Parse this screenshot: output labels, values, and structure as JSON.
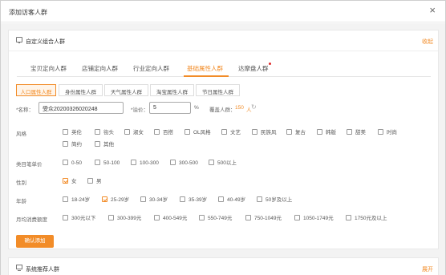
{
  "dialog": {
    "title": "添加访客人群",
    "close": "×"
  },
  "custom_panel": {
    "title": "自定义组合人群",
    "toggle": "收起"
  },
  "tabs": [
    {
      "label": "宝贝定向人群"
    },
    {
      "label": "店铺定向人群"
    },
    {
      "label": "行业定向人群"
    },
    {
      "label": "基础属性人群",
      "active": true
    },
    {
      "label": "达摩盘人群",
      "badge": true
    }
  ],
  "subtabs": [
    {
      "label": "人口属性人群",
      "active": true
    },
    {
      "label": "身份属性人群"
    },
    {
      "label": "天气属性人群"
    },
    {
      "label": "淘宝属性人群"
    },
    {
      "label": "节日属性人群"
    }
  ],
  "form": {
    "name_label": "*名称：",
    "name_value": "受众20200326020248",
    "premium_label": "*溢价：",
    "premium_value": "5",
    "premium_unit": "%",
    "cover_label": "覆盖人群：",
    "cover_value": "150",
    "cover_unit": "人"
  },
  "style": {
    "label": "风格",
    "options": [
      {
        "label": "英伦",
        "checked": false
      },
      {
        "label": "街头",
        "checked": false
      },
      {
        "label": "淑女",
        "checked": false
      },
      {
        "label": "百搭",
        "checked": false
      },
      {
        "label": "OL风格",
        "checked": false
      },
      {
        "label": "文艺",
        "checked": false
      },
      {
        "label": "民族风",
        "checked": false
      },
      {
        "label": "复古",
        "checked": false
      },
      {
        "label": "韩版",
        "checked": false
      },
      {
        "label": "甜美",
        "checked": false
      },
      {
        "label": "时尚",
        "checked": false
      },
      {
        "label": "简约",
        "checked": false
      },
      {
        "label": "其他",
        "checked": false
      }
    ]
  },
  "price": {
    "label": "类目笔单价",
    "options": [
      {
        "label": "0-50",
        "checked": false
      },
      {
        "label": "50-100",
        "checked": false
      },
      {
        "label": "100-300",
        "checked": false
      },
      {
        "label": "300-500",
        "checked": false
      },
      {
        "label": "500以上",
        "checked": false
      }
    ]
  },
  "gender": {
    "label": "性别",
    "options": [
      {
        "label": "女",
        "checked": true
      },
      {
        "label": "男",
        "checked": false
      }
    ]
  },
  "age": {
    "label": "年龄",
    "options": [
      {
        "label": "18-24岁",
        "checked": false
      },
      {
        "label": "25-29岁",
        "checked": true
      },
      {
        "label": "30-34岁",
        "checked": false
      },
      {
        "label": "35-39岁",
        "checked": false
      },
      {
        "label": "40-49岁",
        "checked": false
      },
      {
        "label": "50岁及以上",
        "checked": false
      }
    ]
  },
  "spend": {
    "label": "月均消费额度",
    "options": [
      {
        "label": "300元以下",
        "checked": false
      },
      {
        "label": "300-399元",
        "checked": false
      },
      {
        "label": "400-549元",
        "checked": false
      },
      {
        "label": "550-749元",
        "checked": false
      },
      {
        "label": "750-1049元",
        "checked": false
      },
      {
        "label": "1050-1749元",
        "checked": false
      },
      {
        "label": "1750元及以上",
        "checked": false
      }
    ]
  },
  "confirm_button": "确认添加",
  "recommend_panel": {
    "title": "系统推荐人群",
    "toggle": "展开"
  },
  "colors": {
    "accent": "#f28c28",
    "badge": "#e02a2a"
  }
}
